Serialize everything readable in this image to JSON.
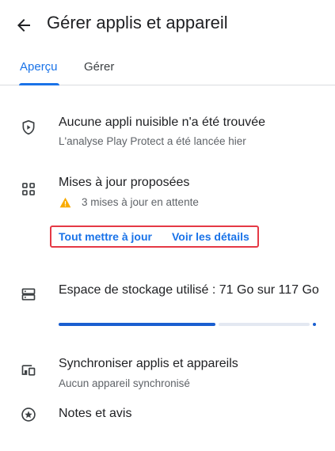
{
  "header": {
    "back_icon": "arrow-back-icon",
    "title": "Gérer applis et appareil"
  },
  "tabs": [
    {
      "label": "Aperçu",
      "active": true
    },
    {
      "label": "Gérer",
      "active": false
    }
  ],
  "protect": {
    "icon": "shield-play-icon",
    "title": "Aucune appli nuisible n'a été trouvée",
    "subtitle": "L'analyse Play Protect a été lancée hier"
  },
  "updates": {
    "icon": "apps-grid-icon",
    "title": "Mises à jour proposées",
    "warning_icon": "warning-triangle-icon",
    "status": "3 mises à jour en attente",
    "update_all_label": "Tout mettre à jour",
    "details_label": "Voir les détails"
  },
  "storage": {
    "icon": "storage-icon",
    "title": "Espace de stockage utilisé : 71 Go sur 117 Go",
    "used_fraction": 0.61
  },
  "sync": {
    "icon": "devices-icon",
    "title": "Synchroniser applis et appareils",
    "subtitle": "Aucun appareil synchronisé"
  },
  "ratings": {
    "icon": "star-circle-icon",
    "title": "Notes et avis"
  },
  "colors": {
    "accent": "#1a73e8",
    "highlight_border": "#e53945",
    "warning": "#f9ab00"
  }
}
